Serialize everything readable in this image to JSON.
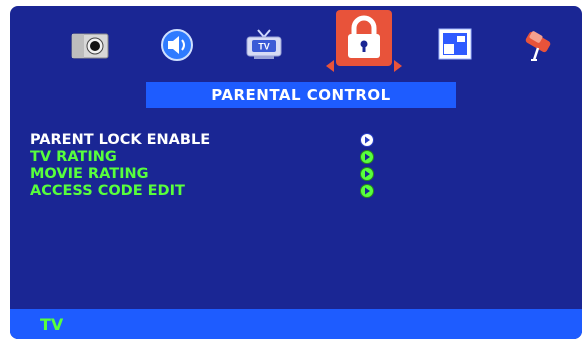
{
  "tabs": [
    {
      "name": "camera-icon"
    },
    {
      "name": "speaker-icon"
    },
    {
      "name": "tv-icon",
      "label": "TV"
    },
    {
      "name": "lock-icon",
      "selected": true
    },
    {
      "name": "picture-icon"
    },
    {
      "name": "tool-icon"
    }
  ],
  "title": "PARENTAL CONTROL",
  "menu": [
    {
      "label": "PARENT LOCK ENABLE",
      "color": "#ffffff"
    },
    {
      "label": "TV RATING",
      "color": "#58ff3c"
    },
    {
      "label": "MOVIE RATING",
      "color": "#58ff3c"
    },
    {
      "label": "ACCESS CODE EDIT",
      "color": "#58ff3c"
    }
  ],
  "footer": {
    "label": "TV"
  },
  "colors": {
    "background": "#1a2694",
    "accent": "#1e5cff",
    "selected": "#e8533a",
    "active_text": "#ffffff",
    "inactive_text": "#58ff3c"
  }
}
